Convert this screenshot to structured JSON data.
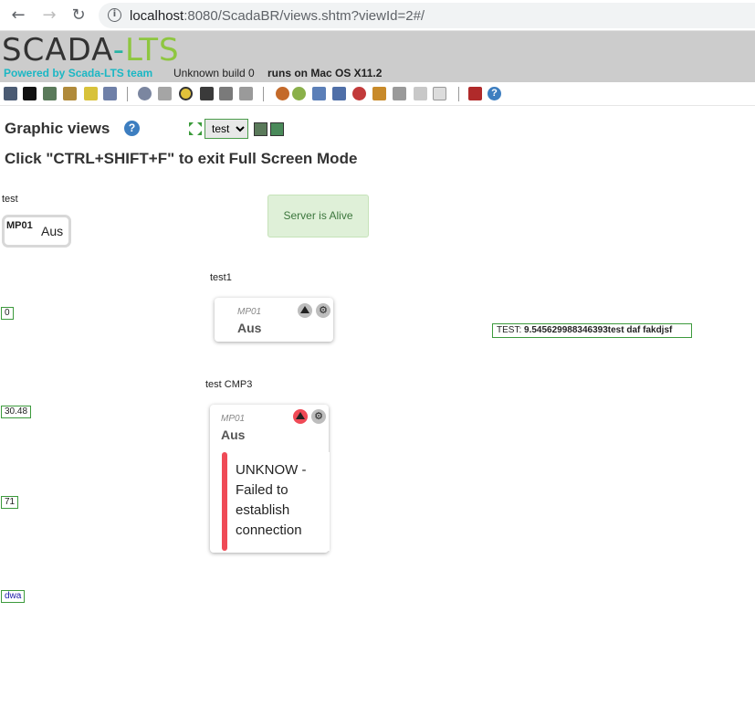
{
  "browser": {
    "url_host": "localhost",
    "url_rest": ":8080/ScadaBR/views.shtm?viewId=2#/"
  },
  "header": {
    "logo_part1": "SCADA",
    "logo_part2": "-",
    "logo_part3": "LTS",
    "powered_by": "Powered by Scada-LTS team",
    "build": "Unknown build 0",
    "runs_on": "runs on Mac OS X11.2"
  },
  "toolbar": {
    "icons": [
      "monitor-icon",
      "display-icon",
      "image-icon",
      "edit-icon",
      "broom-icon",
      "book-icon",
      "gear-icon",
      "database-icon",
      "clock-icon",
      "pin-icon",
      "plane-icon",
      "scale-icon",
      "user-icon",
      "users-icon",
      "folder-icon",
      "book2-icon",
      "antenna-icon",
      "hammer-icon",
      "archive-icon",
      "code-icon",
      "document-icon",
      "logout-icon",
      "help-icon"
    ]
  },
  "page": {
    "title": "Graphic views",
    "selected_view": "test",
    "view_options": [
      "test"
    ],
    "fullscreen_message": "Click \"CTRL+SHIFT+F\" to exit Full Screen Mode"
  },
  "view": {
    "label_test": "test",
    "simple_point": {
      "name": "MP01",
      "value": "Aus"
    },
    "server_status": "Server is Alive",
    "label_test1": "test1",
    "card1": {
      "name": "MP01",
      "value": "Aus"
    },
    "label_cmp3": "test CMP3",
    "card2": {
      "name": "MP01",
      "value": "Aus",
      "error": "UNKNOW - Failed to establish connection"
    },
    "test_label_prefix": "TEST:",
    "test_label_value": "9.545629988346393test daf fakdjsf",
    "values": [
      "0",
      "30.48",
      "71",
      "dwa"
    ]
  },
  "colors": {
    "accent_green": "#8ec640",
    "accent_teal": "#28b3a4",
    "alarm_red": "#ef4a56",
    "alive_bg": "#dff0d8"
  }
}
